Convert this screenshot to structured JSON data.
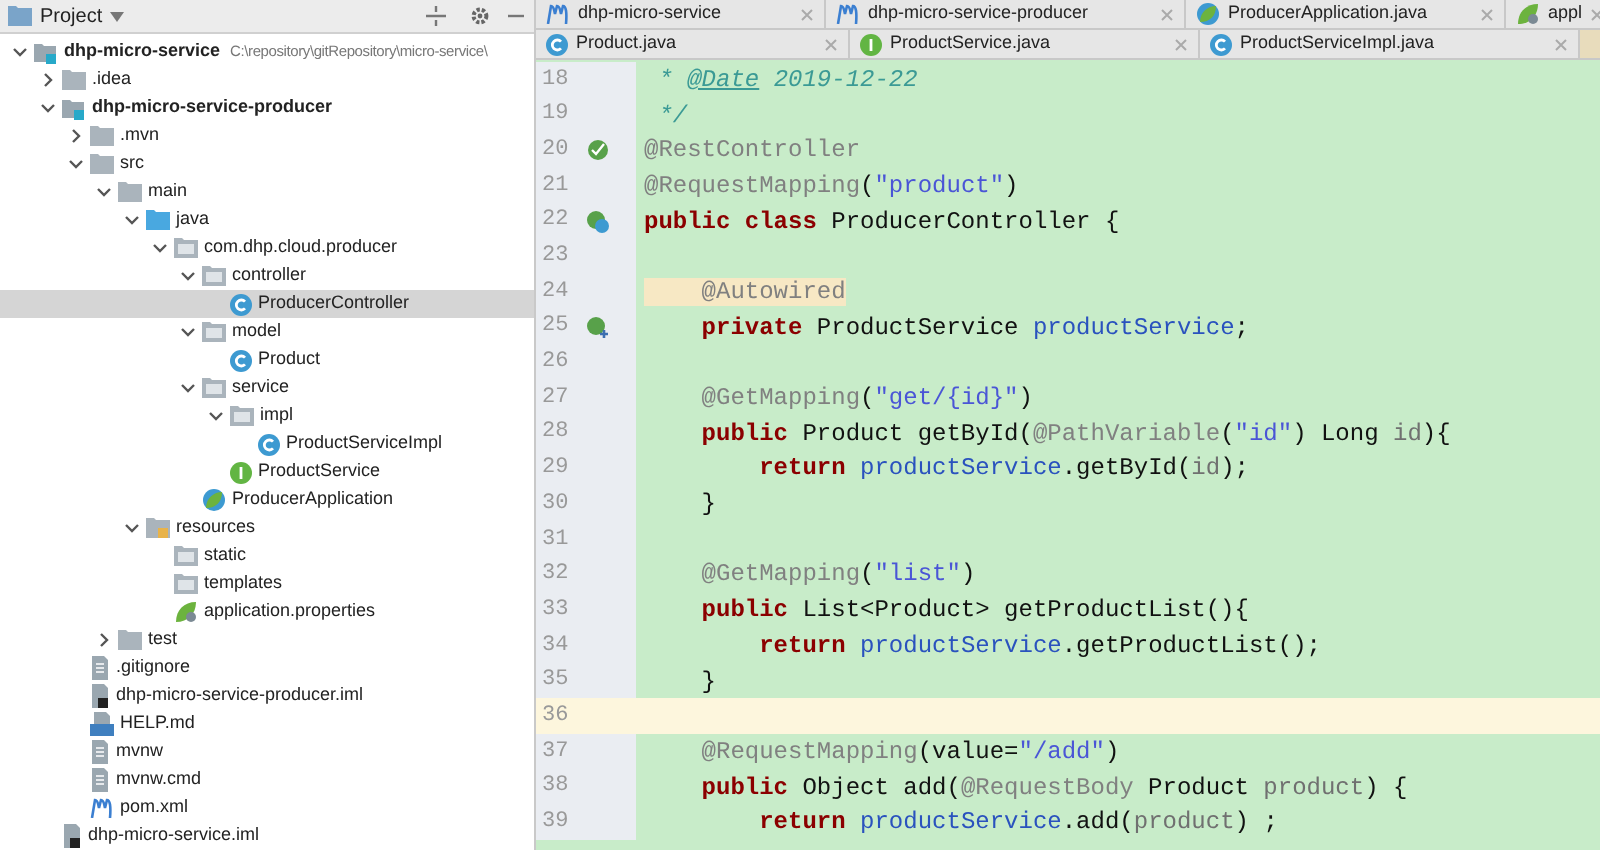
{
  "project_panel": {
    "title": "Project",
    "tree": [
      {
        "label": "dhp-micro-service",
        "kind": "module",
        "path": "C:\\repository\\gitRepository\\micro-service\\",
        "expanded": true,
        "selected": false,
        "children": [
          {
            "label": ".idea",
            "kind": "folder",
            "expanded": false,
            "selected": false
          },
          {
            "label": "dhp-micro-service-producer",
            "kind": "module",
            "expanded": true,
            "selected": false,
            "children": [
              {
                "label": ".mvn",
                "kind": "folder",
                "expanded": false,
                "selected": false
              },
              {
                "label": "src",
                "kind": "folder",
                "expanded": true,
                "selected": false,
                "children": [
                  {
                    "label": "main",
                    "kind": "folder",
                    "expanded": true,
                    "selected": false,
                    "children": [
                      {
                        "label": "java",
                        "kind": "source",
                        "expanded": true,
                        "selected": false,
                        "children": [
                          {
                            "label": "com.dhp.cloud.producer",
                            "kind": "package",
                            "expanded": true,
                            "selected": false,
                            "children": [
                              {
                                "label": "controller",
                                "kind": "package",
                                "expanded": true,
                                "selected": false,
                                "children": [
                                  {
                                    "label": "ProducerController",
                                    "kind": "class",
                                    "selected": true
                                  }
                                ]
                              },
                              {
                                "label": "model",
                                "kind": "package",
                                "expanded": true,
                                "selected": false,
                                "children": [
                                  {
                                    "label": "Product",
                                    "kind": "class",
                                    "selected": false
                                  }
                                ]
                              },
                              {
                                "label": "service",
                                "kind": "package",
                                "expanded": true,
                                "selected": false,
                                "children": [
                                  {
                                    "label": "impl",
                                    "kind": "package",
                                    "expanded": true,
                                    "selected": false,
                                    "children": [
                                      {
                                        "label": "ProductServiceImpl",
                                        "kind": "class",
                                        "selected": false
                                      }
                                    ]
                                  },
                                  {
                                    "label": "ProductService",
                                    "kind": "interface",
                                    "selected": false
                                  }
                                ]
                              },
                              {
                                "label": "ProducerApplication",
                                "kind": "app",
                                "selected": false
                              }
                            ]
                          }
                        ]
                      },
                      {
                        "label": "resources",
                        "kind": "resources",
                        "expanded": true,
                        "selected": false,
                        "children": [
                          {
                            "label": "static",
                            "kind": "package",
                            "selected": false
                          },
                          {
                            "label": "templates",
                            "kind": "package",
                            "selected": false
                          },
                          {
                            "label": "application.properties",
                            "kind": "properties",
                            "selected": false
                          }
                        ]
                      }
                    ]
                  },
                  {
                    "label": "test",
                    "kind": "folder",
                    "expanded": false,
                    "selected": false
                  }
                ]
              },
              {
                "label": ".gitignore",
                "kind": "file",
                "selected": false
              },
              {
                "label": "dhp-micro-service-producer.iml",
                "kind": "iml",
                "selected": false
              },
              {
                "label": "HELP.md",
                "kind": "md",
                "selected": false
              },
              {
                "label": "mvnw",
                "kind": "file",
                "selected": false
              },
              {
                "label": "mvnw.cmd",
                "kind": "file",
                "selected": false
              },
              {
                "label": "pom.xml",
                "kind": "maven",
                "selected": false
              }
            ]
          },
          {
            "label": "dhp-micro-service.iml",
            "kind": "iml",
            "selected": false
          }
        ]
      }
    ]
  },
  "editor_tabs": [
    [
      {
        "label": "dhp-micro-service",
        "kind": "maven",
        "selected": false
      },
      {
        "label": "dhp-micro-service-producer",
        "kind": "maven",
        "selected": false
      },
      {
        "label": "ProducerApplication.java",
        "kind": "app",
        "selected": false
      },
      {
        "label": "appl",
        "kind": "properties",
        "selected": false
      }
    ],
    [
      {
        "label": "Product.java",
        "kind": "class",
        "selected": false
      },
      {
        "label": "ProductService.java",
        "kind": "interface",
        "selected": false
      },
      {
        "label": "ProductServiceImpl.java",
        "kind": "class",
        "selected": false
      }
    ]
  ],
  "code_lines": [
    {
      "number": "18",
      "current": false,
      "tokens": [
        {
          "kind": "doc",
          "text": " * "
        },
        {
          "kind": "doctag",
          "text": "@Date"
        },
        {
          "kind": "doc",
          "text": " 2019-12-22"
        }
      ]
    },
    {
      "number": "19",
      "current": false,
      "tokens": [
        {
          "kind": "doc",
          "text": " */"
        }
      ]
    },
    {
      "number": "20",
      "current": false,
      "gutter": {
        "kind": "bean"
      },
      "tokens": [
        {
          "kind": "ann",
          "text": "@RestController"
        }
      ]
    },
    {
      "number": "21",
      "current": false,
      "tokens": [
        {
          "kind": "ann",
          "text": "@RequestMapping"
        },
        {
          "kind": "plain",
          "text": "("
        },
        {
          "kind": "str",
          "text": "\"product\""
        },
        {
          "kind": "plain",
          "text": ")"
        }
      ]
    },
    {
      "number": "22",
      "current": false,
      "gutter": {
        "kind": "class"
      },
      "tokens": [
        {
          "kind": "kw",
          "text": "public class "
        },
        {
          "kind": "plain",
          "text": "ProducerController {"
        }
      ]
    },
    {
      "number": "23",
      "current": false
    },
    {
      "number": "24",
      "current": false,
      "tokens": [
        {
          "kind": "annhl",
          "text": "    @Autowired"
        }
      ]
    },
    {
      "number": "25",
      "current": false,
      "gutter": {
        "kind": "inject"
      },
      "tokens": [
        {
          "kind": "kw",
          "text": "    private "
        },
        {
          "kind": "plain",
          "text": "ProductService "
        },
        {
          "kind": "field",
          "text": "productService"
        },
        {
          "kind": "plain",
          "text": ";"
        }
      ]
    },
    {
      "number": "26",
      "current": false
    },
    {
      "number": "27",
      "current": false,
      "tokens": [
        {
          "kind": "ann",
          "text": "    @GetMapping"
        },
        {
          "kind": "plain",
          "text": "("
        },
        {
          "kind": "str",
          "text": "\"get/{id}\""
        },
        {
          "kind": "plain",
          "text": ")"
        }
      ]
    },
    {
      "number": "28",
      "current": false,
      "tokens": [
        {
          "kind": "kw",
          "text": "    public "
        },
        {
          "kind": "plain",
          "text": "Product getById("
        },
        {
          "kind": "ann",
          "text": "@PathVariable"
        },
        {
          "kind": "plain",
          "text": "("
        },
        {
          "kind": "str",
          "text": "\"id\""
        },
        {
          "kind": "plain",
          "text": ") Long "
        },
        {
          "kind": "param",
          "text": "id"
        },
        {
          "kind": "plain",
          "text": "){"
        }
      ]
    },
    {
      "number": "29",
      "current": false,
      "tokens": [
        {
          "kind": "kw",
          "text": "        return "
        },
        {
          "kind": "field",
          "text": "productService"
        },
        {
          "kind": "plain",
          "text": ".getById("
        },
        {
          "kind": "param",
          "text": "id"
        },
        {
          "kind": "plain",
          "text": ");"
        }
      ]
    },
    {
      "number": "30",
      "current": false,
      "tokens": [
        {
          "kind": "plain",
          "text": "    }"
        }
      ]
    },
    {
      "number": "31",
      "current": false
    },
    {
      "number": "32",
      "current": false,
      "tokens": [
        {
          "kind": "ann",
          "text": "    @GetMapping"
        },
        {
          "kind": "plain",
          "text": "("
        },
        {
          "kind": "str",
          "text": "\"list\""
        },
        {
          "kind": "plain",
          "text": ")"
        }
      ]
    },
    {
      "number": "33",
      "current": false,
      "tokens": [
        {
          "kind": "kw",
          "text": "    public "
        },
        {
          "kind": "plain",
          "text": "List<Product> getProductList(){"
        }
      ]
    },
    {
      "number": "34",
      "current": false,
      "tokens": [
        {
          "kind": "kw",
          "text": "        return "
        },
        {
          "kind": "field",
          "text": "productService"
        },
        {
          "kind": "plain",
          "text": ".getProductList();"
        }
      ]
    },
    {
      "number": "35",
      "current": false,
      "tokens": [
        {
          "kind": "plain",
          "text": "    }"
        }
      ]
    },
    {
      "number": "36",
      "current": true
    },
    {
      "number": "37",
      "current": false,
      "tokens": [
        {
          "kind": "ann",
          "text": "    @RequestMapping"
        },
        {
          "kind": "plain",
          "text": "(value="
        },
        {
          "kind": "str",
          "text": "\"/add\""
        },
        {
          "kind": "plain",
          "text": ")"
        }
      ]
    },
    {
      "number": "38",
      "current": false,
      "tokens": [
        {
          "kind": "kw",
          "text": "    public "
        },
        {
          "kind": "plain",
          "text": "Object add("
        },
        {
          "kind": "ann",
          "text": "@RequestBody"
        },
        {
          "kind": "plain",
          "text": " Product "
        },
        {
          "kind": "param",
          "text": "product"
        },
        {
          "kind": "plain",
          "text": ") {"
        }
      ]
    },
    {
      "number": "39",
      "current": false,
      "tokens": [
        {
          "kind": "kw",
          "text": "        return "
        },
        {
          "kind": "field",
          "text": "productService"
        },
        {
          "kind": "plain",
          "text": ".add("
        },
        {
          "kind": "param",
          "text": "product"
        },
        {
          "kind": "plain",
          "text": ") ;"
        }
      ]
    }
  ]
}
